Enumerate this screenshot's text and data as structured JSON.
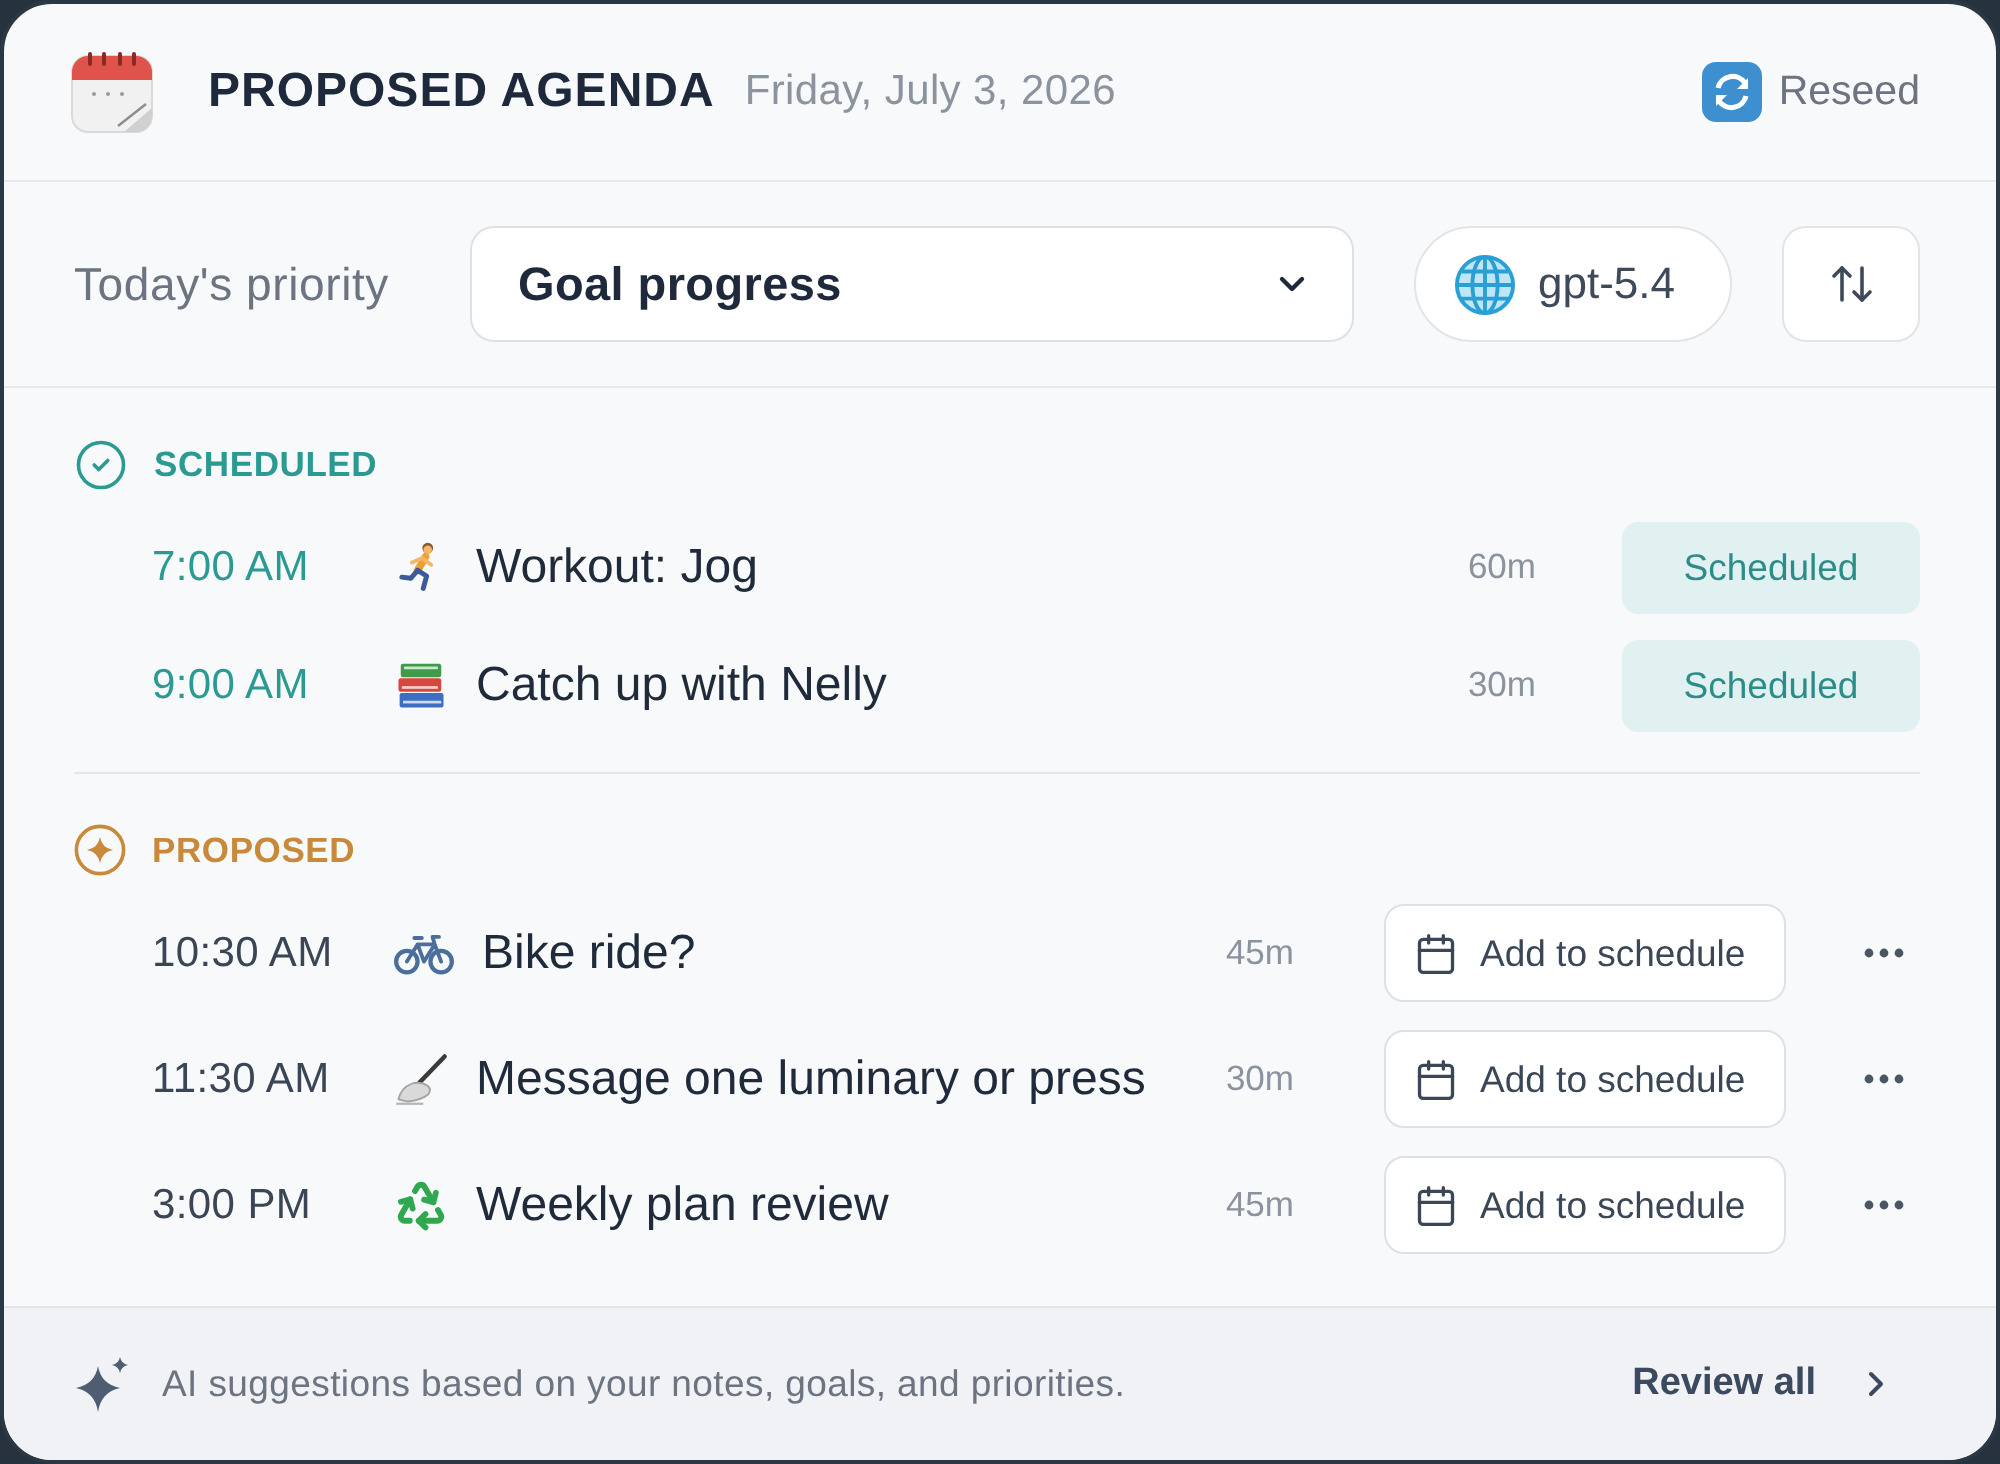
{
  "header": {
    "title": "PROPOSED AGENDA",
    "date": "Friday, July 3, 2026",
    "reseed_button": "Reseed"
  },
  "controls": {
    "priority_label": "Today's priority",
    "priority_select": {
      "value": "Goal progress"
    },
    "model_button": "gpt-5.4"
  },
  "sections": [
    {
      "kind": "scheduled",
      "title": "SCHEDULED",
      "items": [
        {
          "kind": "running",
          "time": "7:00 AM",
          "title": "Workout: Jog",
          "duration": "60m",
          "status": "Scheduled"
        },
        {
          "kind": "books",
          "time": "9:00 AM",
          "title": "Catch up with Nelly",
          "duration": "30m",
          "status": "Scheduled"
        }
      ]
    },
    {
      "kind": "proposed",
      "title": "PROPOSED",
      "items": [
        {
          "kind": "bicycle",
          "time": "10:30 AM",
          "title": "Bike ride?",
          "duration": "45m",
          "action": "Add to schedule"
        },
        {
          "kind": "writing",
          "time": "11:30 AM",
          "title": "Message one luminary or press",
          "duration": "30m",
          "action": "Add to schedule"
        },
        {
          "kind": "recycle",
          "time": "3:00 PM",
          "title": "Weekly plan review",
          "duration": "45m",
          "action": "Add to schedule"
        }
      ]
    }
  ],
  "footer": {
    "note": "AI suggestions based on your notes, goals, and priorities.",
    "link": "Review all"
  }
}
